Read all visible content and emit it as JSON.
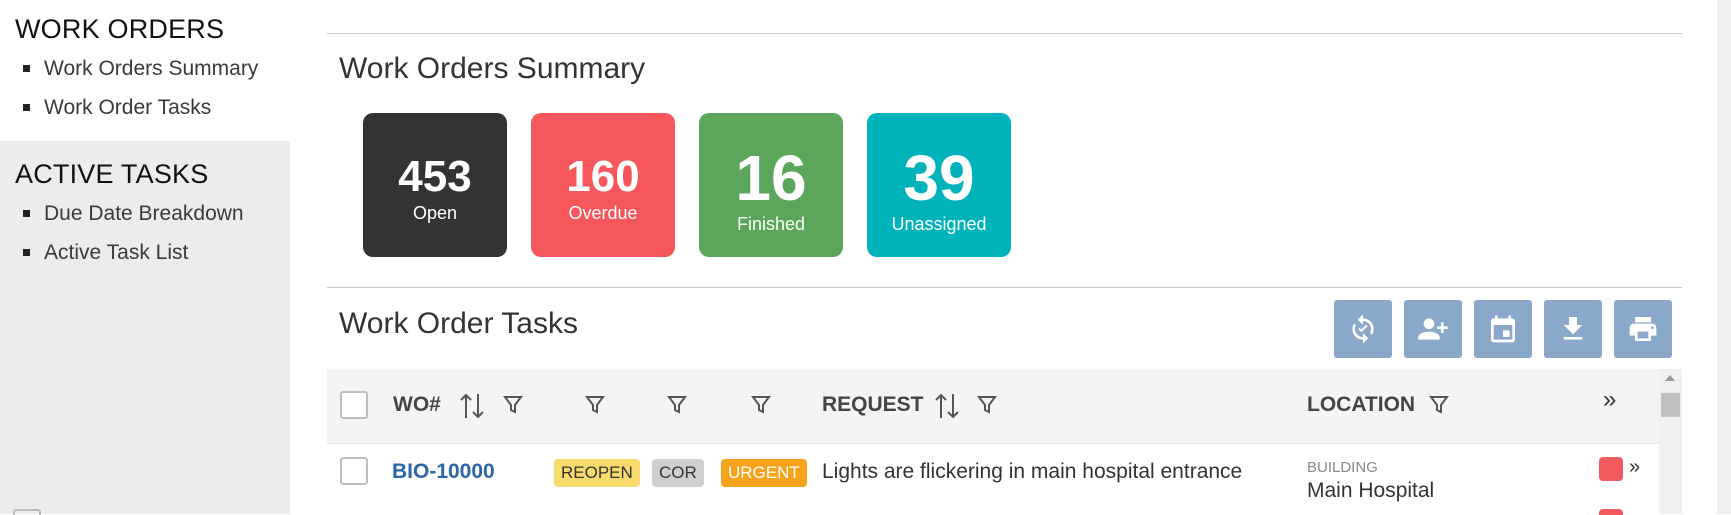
{
  "sidebar": {
    "sections": [
      {
        "title": "WORK ORDERS",
        "items": [
          "Work Orders Summary",
          "Work Order Tasks"
        ]
      },
      {
        "title": "ACTIVE TASKS",
        "items": [
          "Due Date Breakdown",
          "Active Task List"
        ]
      }
    ]
  },
  "summary": {
    "title": "Work Orders Summary",
    "cards": [
      {
        "value": "453",
        "label": "Open",
        "color": "#333333"
      },
      {
        "value": "160",
        "label": "Overdue",
        "color": "#f5575c"
      },
      {
        "value": "16",
        "label": "Finished",
        "color": "#5ba65a"
      },
      {
        "value": "39",
        "label": "Unassigned",
        "color": "#00b2b9"
      }
    ]
  },
  "tasks": {
    "title": "Work Order Tasks",
    "toolbar": [
      "refresh-sync-icon",
      "assign-user-icon",
      "calendar-icon",
      "download-icon",
      "print-icon"
    ],
    "columns": {
      "wo": "WO#",
      "request": "REQUEST",
      "location": "LOCATION",
      "expand": "»"
    },
    "rows": [
      {
        "wo": "BIO-10000",
        "badges": [
          {
            "text": "REOPEN",
            "bg": "#f8da6d",
            "fg": "#333333"
          },
          {
            "text": "COR",
            "bg": "#cfcfcf",
            "fg": "#333333"
          },
          {
            "text": "URGENT",
            "bg": "#f7a21b",
            "fg": "#ffffff"
          }
        ],
        "request": "Lights are flickering in main hospital entrance",
        "location_caption": "BUILDING",
        "location": "Main Hospital",
        "status_color": "#f25a5f",
        "expand": "»"
      }
    ]
  },
  "colors": {
    "toolbar_button": "#8aa8ca",
    "link": "#2a66a8"
  }
}
